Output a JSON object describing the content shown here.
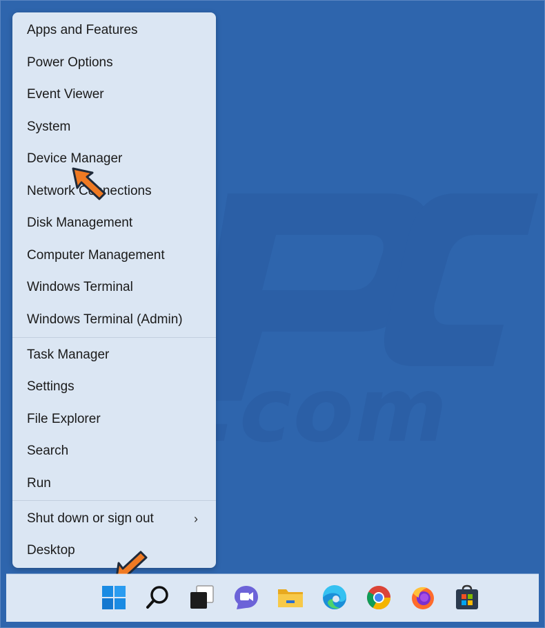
{
  "menu": {
    "items": [
      {
        "label": "Apps and Features"
      },
      {
        "label": "Power Options"
      },
      {
        "label": "Event Viewer"
      },
      {
        "label": "System"
      },
      {
        "label": "Device Manager"
      },
      {
        "label": "Network Connections"
      },
      {
        "label": "Disk Management"
      },
      {
        "label": "Computer Management"
      },
      {
        "label": "Windows Terminal"
      },
      {
        "label": "Windows Terminal (Admin)"
      },
      {
        "label": "Task Manager"
      },
      {
        "label": "Settings"
      },
      {
        "label": "File Explorer"
      },
      {
        "label": "Search"
      },
      {
        "label": "Run"
      },
      {
        "label": "Shut down or sign out"
      },
      {
        "label": "Desktop"
      }
    ],
    "submenu_chevron": "›"
  },
  "watermark": {
    "text": "risk.com"
  },
  "taskbar": {
    "icons": [
      "windows-start-icon",
      "search-icon",
      "task-view-icon",
      "teams-chat-icon",
      "file-explorer-icon",
      "edge-icon",
      "chrome-icon",
      "firefox-icon",
      "microsoft-store-icon"
    ]
  },
  "colors": {
    "desktop_bg": "#2e65ad",
    "menu_bg": "#dbe6f3",
    "taskbar_bg": "#dce7f4",
    "arrow_orange": "#ef7a23"
  }
}
